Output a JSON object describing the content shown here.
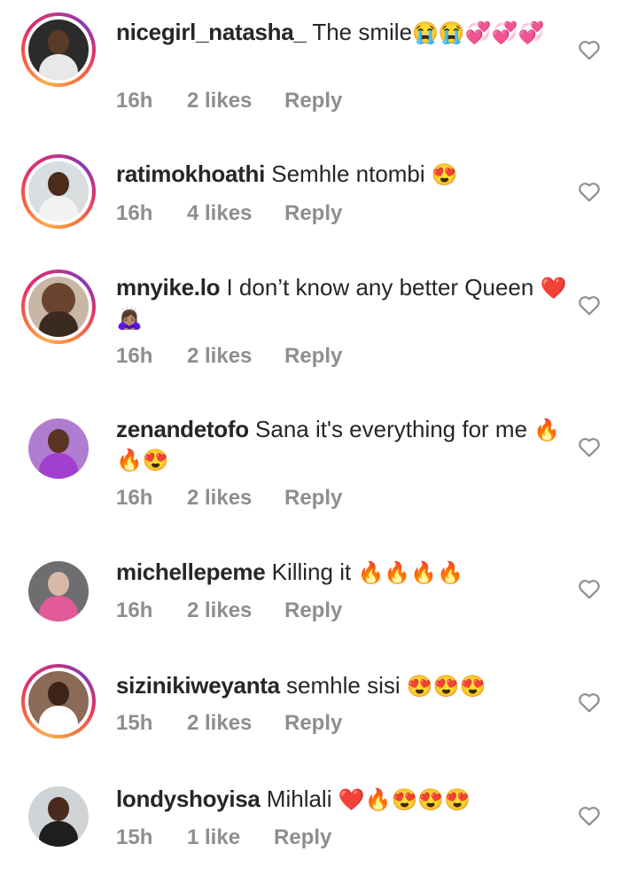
{
  "comments": [
    {
      "username": "nicegirl_natasha_",
      "text": "The smile",
      "emoji": "😭😭💞💞💞",
      "time": "16h",
      "likes": "2 likes",
      "reply": "Reply"
    },
    {
      "username": "ratimokhoathi",
      "text": "Semhle ntombi",
      "emoji": "😍",
      "time": "16h",
      "likes": "4 likes",
      "reply": "Reply"
    },
    {
      "username": "mnyike.lo",
      "text": "I don’t know any better Queen",
      "emoji": "❤️🙇🏽‍♀️",
      "time": "16h",
      "likes": "2 likes",
      "reply": "Reply"
    },
    {
      "username": "zenandetofo",
      "text": "Sana it's everything for me",
      "emoji": "🔥🔥😍",
      "time": "16h",
      "likes": "2 likes",
      "reply": "Reply"
    },
    {
      "username": "michellepeme",
      "text": "Killing it",
      "emoji": "🔥🔥🔥🔥",
      "time": "16h",
      "likes": "2 likes",
      "reply": "Reply"
    },
    {
      "username": "sizinikiweyanta",
      "text": "semhle sisi",
      "emoji": "😍😍😍",
      "time": "15h",
      "likes": "2 likes",
      "reply": "Reply"
    },
    {
      "username": "londyshoyisa",
      "text": "Mihlali",
      "emoji": "❤️🔥😍😍😍",
      "time": "15h",
      "likes": "1 like",
      "reply": "Reply"
    }
  ],
  "colors": {
    "meta_gray": "#8e8e8e",
    "text": "#262626",
    "story_ring": "#e1306c"
  },
  "icons": {
    "like": "heart-outline-icon"
  }
}
